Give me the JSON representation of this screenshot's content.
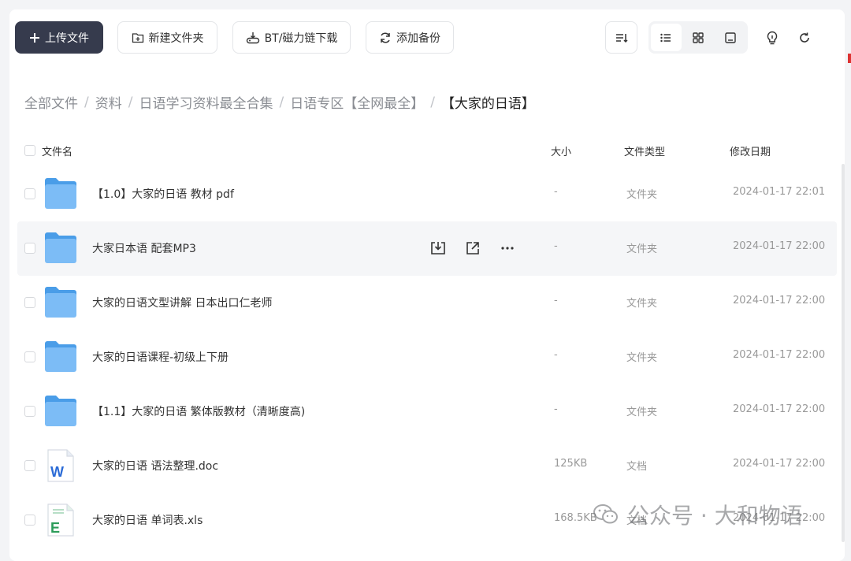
{
  "toolbar": {
    "upload_label": "上传文件",
    "newfolder_label": "新建文件夹",
    "bt_label": "BT/磁力链下载",
    "backup_label": "添加备份"
  },
  "breadcrumb": {
    "items": [
      "全部文件",
      "资料",
      "日语学习资料最全合集",
      "日语专区【全网最全】",
      "【大家的日语】"
    ],
    "separator": "/"
  },
  "table": {
    "columns": {
      "name": "文件名",
      "size": "大小",
      "type": "文件类型",
      "date": "修改日期"
    },
    "rows": [
      {
        "name": "【1.0】大家的日语 教材 pdf",
        "size": "-",
        "type": "文件夹",
        "date": "2024-01-17 22:01",
        "icon": "folder-icon"
      },
      {
        "name": "大家日本语 配套MP3",
        "size": "-",
        "type": "文件夹",
        "date": "2024-01-17 22:00",
        "icon": "folder-icon"
      },
      {
        "name": "大家的日语文型讲解 日本出口仁老师",
        "size": "-",
        "type": "文件夹",
        "date": "2024-01-17 22:00",
        "icon": "folder-icon"
      },
      {
        "name": "大家的日语课程-初级上下册",
        "size": "-",
        "type": "文件夹",
        "date": "2024-01-17 22:00",
        "icon": "folder-icon"
      },
      {
        "name": "【1.1】大家的日语 繁体版教材（清晰度高)",
        "size": "-",
        "type": "文件夹",
        "date": "2024-01-17 22:00",
        "icon": "folder-icon"
      },
      {
        "name": "大家的日语 语法整理.doc",
        "size": "125KB",
        "type": "文档",
        "date": "2024-01-17 22:00",
        "icon": "word-doc-icon"
      },
      {
        "name": "大家的日语 单词表.xls",
        "size": "168.5KB",
        "type": "文档",
        "date": "2024-01-17 22:00",
        "icon": "excel-sheet-icon"
      }
    ]
  },
  "watermark": {
    "text": "公众号 · 大和物语"
  },
  "colors": {
    "primary_button": "#363b4d",
    "folder": "#6fb5f5",
    "hover_row": "#f5f6f8",
    "word": "#2b6bd6",
    "excel": "#2c9c5a"
  }
}
